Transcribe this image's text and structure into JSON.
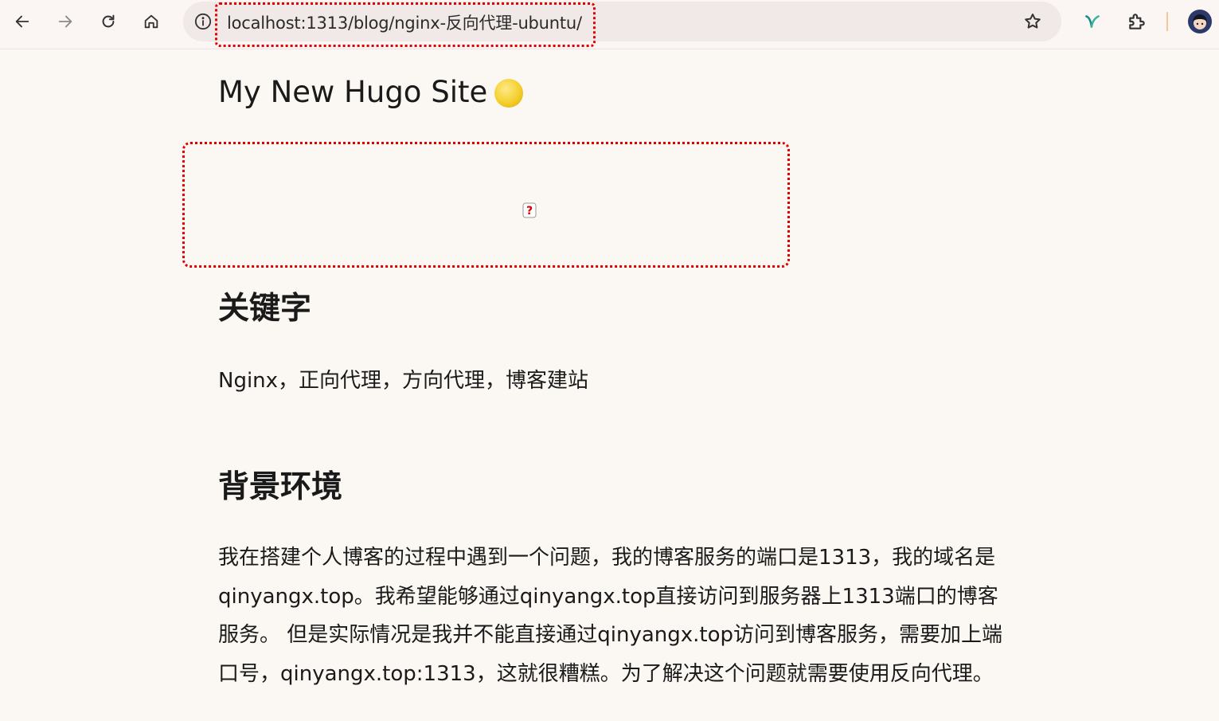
{
  "browser": {
    "url": "localhost:1313/blog/nginx-反向代理-ubuntu/",
    "icons": {
      "back": "back-arrow-icon",
      "forward": "forward-arrow-icon",
      "reload": "reload-icon",
      "home": "home-icon",
      "info": "info-icon",
      "bookmark": "star-icon",
      "extension_app": "leaf-extension-icon",
      "extensions": "puzzle-icon",
      "profile": "avatar-icon"
    }
  },
  "page": {
    "site_title": "My New Hugo Site",
    "image_alt_icon": "broken-image-icon",
    "sections": [
      {
        "heading": "关键字",
        "text": "Nginx，正向代理，方向代理，博客建站"
      },
      {
        "heading": "背景环境",
        "lines": [
          "我在搭建个人博客的过程中遇到一个问题，我的博客服务的端口是1313，我的域名是",
          "qinyangx.top。我希望能够通过qinyangx.top直接访问到服务器上1313端口的博客",
          "服务。 但是实际情况是我并不能直接通过qinyangx.top访问到博客服务，需要加上端",
          "口号，qinyangx.top:1313，这就很糟糕。为了解决这个问题就需要使用反向代理。"
        ]
      }
    ]
  },
  "colors": {
    "highlight": "#e10000",
    "background": "#fbf8f3",
    "moon": "#f4cf2c"
  }
}
